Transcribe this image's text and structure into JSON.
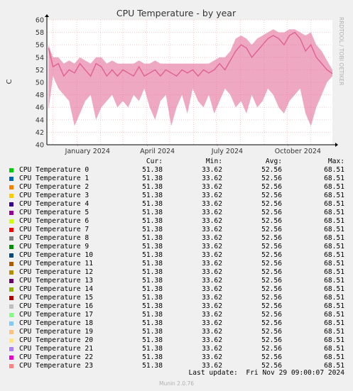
{
  "chart_data": {
    "type": "line",
    "title": "CPU Temperature - by year",
    "ylabel": "C",
    "ylim": [
      40,
      60
    ],
    "yticks": [
      "40",
      "42",
      "44",
      "46",
      "48",
      "50",
      "52",
      "54",
      "56",
      "58",
      "60"
    ],
    "xticks": [
      "January 2024",
      "April 2024",
      "July 2024",
      "October 2024"
    ],
    "xlim": [
      "2023-11-23",
      "2024-11-29"
    ],
    "grid": true,
    "series_color": "#e06090",
    "series": [
      {
        "name": "CPU Temperature 0",
        "x": [
          "2023-11-25",
          "2023-12-01",
          "2023-12-08",
          "2023-12-15",
          "2023-12-22",
          "2023-12-29",
          "2024-01-05",
          "2024-01-12",
          "2024-01-19",
          "2024-01-26",
          "2024-02-02",
          "2024-02-09",
          "2024-02-16",
          "2024-02-23",
          "2024-03-01",
          "2024-03-08",
          "2024-03-15",
          "2024-03-22",
          "2024-03-29",
          "2024-04-05",
          "2024-04-12",
          "2024-04-19",
          "2024-04-26",
          "2024-05-03",
          "2024-05-10",
          "2024-05-17",
          "2024-05-24",
          "2024-05-31",
          "2024-06-07",
          "2024-06-14",
          "2024-06-21",
          "2024-06-28",
          "2024-07-05",
          "2024-07-12",
          "2024-07-19",
          "2024-07-26",
          "2024-08-02",
          "2024-08-09",
          "2024-08-16",
          "2024-08-23",
          "2024-08-30",
          "2024-09-06",
          "2024-09-13",
          "2024-09-20",
          "2024-09-27",
          "2024-10-04",
          "2024-10-11",
          "2024-10-18",
          "2024-10-25",
          "2024-11-01",
          "2024-11-08",
          "2024-11-15",
          "2024-11-22",
          "2024-11-29"
        ],
        "y": [
          55.5,
          52.5,
          53,
          51,
          52,
          51.5,
          53,
          52,
          51,
          53,
          52.5,
          51,
          52,
          51,
          52,
          51.5,
          51,
          52.5,
          51,
          51.5,
          52,
          51,
          52,
          51.5,
          51,
          52,
          51.5,
          52,
          51,
          52,
          51.5,
          52,
          53,
          52,
          53.5,
          55,
          56,
          55.5,
          54,
          55,
          56,
          57,
          57.5,
          57,
          56,
          57.5,
          58,
          57,
          55,
          56,
          54,
          53,
          52,
          51.4
        ],
        "ymin": [
          45.5,
          51,
          49,
          48,
          47,
          43,
          45,
          47,
          48,
          44,
          46,
          47,
          48,
          46,
          47,
          46,
          48,
          47,
          49,
          46,
          44,
          47,
          48,
          43,
          46,
          48,
          45,
          49,
          47,
          46,
          48,
          45,
          47,
          49,
          48,
          46,
          47,
          45,
          48,
          46,
          47,
          49,
          48,
          46,
          45,
          47,
          48,
          49,
          45,
          43,
          46,
          48,
          50,
          51
        ],
        "ymax": [
          56,
          54,
          54,
          53,
          53.5,
          53,
          54,
          53.5,
          53,
          54,
          54,
          53,
          53.5,
          53,
          53,
          53,
          53,
          53.5,
          53,
          53,
          53.5,
          53,
          53,
          53,
          53,
          53,
          53,
          53,
          53,
          53,
          53,
          53.5,
          54,
          54,
          55,
          57,
          57.5,
          57,
          56,
          57,
          57.5,
          58,
          58.5,
          58,
          58,
          58.5,
          58.5,
          58,
          57.5,
          58,
          56,
          55,
          53.5,
          52
        ]
      }
    ]
  },
  "legend": {
    "headers": [
      "Cur:",
      "Min:",
      "Avg:",
      "Max:"
    ],
    "rows": [
      {
        "name": "CPU Temperature 0",
        "color": "#00cc00",
        "cur": "51.38",
        "min": "33.62",
        "avg": "52.56",
        "max": "68.51"
      },
      {
        "name": "CPU Temperature 1",
        "color": "#0066b3",
        "cur": "51.38",
        "min": "33.62",
        "avg": "52.56",
        "max": "68.51"
      },
      {
        "name": "CPU Temperature 2",
        "color": "#ff8000",
        "cur": "51.38",
        "min": "33.62",
        "avg": "52.56",
        "max": "68.51"
      },
      {
        "name": "CPU Temperature 3",
        "color": "#ffcc00",
        "cur": "51.38",
        "min": "33.62",
        "avg": "52.56",
        "max": "68.51"
      },
      {
        "name": "CPU Temperature 4",
        "color": "#330099",
        "cur": "51.38",
        "min": "33.62",
        "avg": "52.56",
        "max": "68.51"
      },
      {
        "name": "CPU Temperature 5",
        "color": "#990099",
        "cur": "51.38",
        "min": "33.62",
        "avg": "52.56",
        "max": "68.51"
      },
      {
        "name": "CPU Temperature 6",
        "color": "#ccff00",
        "cur": "51.38",
        "min": "33.62",
        "avg": "52.56",
        "max": "68.51"
      },
      {
        "name": "CPU Temperature 7",
        "color": "#ff0000",
        "cur": "51.38",
        "min": "33.62",
        "avg": "52.56",
        "max": "68.51"
      },
      {
        "name": "CPU Temperature 8",
        "color": "#808080",
        "cur": "51.38",
        "min": "33.62",
        "avg": "52.56",
        "max": "68.51"
      },
      {
        "name": "CPU Temperature 9",
        "color": "#008f00",
        "cur": "51.38",
        "min": "33.62",
        "avg": "52.56",
        "max": "68.51"
      },
      {
        "name": "CPU Temperature 10",
        "color": "#00487d",
        "cur": "51.38",
        "min": "33.62",
        "avg": "52.56",
        "max": "68.51"
      },
      {
        "name": "CPU Temperature 11",
        "color": "#b35a00",
        "cur": "51.38",
        "min": "33.62",
        "avg": "52.56",
        "max": "68.51"
      },
      {
        "name": "CPU Temperature 12",
        "color": "#b38f00",
        "cur": "51.38",
        "min": "33.62",
        "avg": "52.56",
        "max": "68.51"
      },
      {
        "name": "CPU Temperature 13",
        "color": "#6b006b",
        "cur": "51.38",
        "min": "33.62",
        "avg": "52.56",
        "max": "68.51"
      },
      {
        "name": "CPU Temperature 14",
        "color": "#8fb300",
        "cur": "51.38",
        "min": "33.62",
        "avg": "52.56",
        "max": "68.51"
      },
      {
        "name": "CPU Temperature 15",
        "color": "#b30000",
        "cur": "51.38",
        "min": "33.62",
        "avg": "52.56",
        "max": "68.51"
      },
      {
        "name": "CPU Temperature 16",
        "color": "#bebebe",
        "cur": "51.38",
        "min": "33.62",
        "avg": "52.56",
        "max": "68.51"
      },
      {
        "name": "CPU Temperature 17",
        "color": "#80ff80",
        "cur": "51.38",
        "min": "33.62",
        "avg": "52.56",
        "max": "68.51"
      },
      {
        "name": "CPU Temperature 18",
        "color": "#80c9ff",
        "cur": "51.38",
        "min": "33.62",
        "avg": "52.56",
        "max": "68.51"
      },
      {
        "name": "CPU Temperature 19",
        "color": "#ffc080",
        "cur": "51.38",
        "min": "33.62",
        "avg": "52.56",
        "max": "68.51"
      },
      {
        "name": "CPU Temperature 20",
        "color": "#ffe680",
        "cur": "51.38",
        "min": "33.62",
        "avg": "52.56",
        "max": "68.51"
      },
      {
        "name": "CPU Temperature 21",
        "color": "#aa80ff",
        "cur": "51.38",
        "min": "33.62",
        "avg": "52.56",
        "max": "68.51"
      },
      {
        "name": "CPU Temperature 22",
        "color": "#ee00cc",
        "cur": "51.38",
        "min": "33.62",
        "avg": "52.56",
        "max": "68.51"
      },
      {
        "name": "CPU Temperature 23",
        "color": "#ff8080",
        "cur": "51.38",
        "min": "33.62",
        "avg": "52.56",
        "max": "68.51"
      }
    ]
  },
  "footer": {
    "last_update": "Last update:  Fri Nov 29 09:00:07 2024",
    "version": "Munin 2.0.76"
  },
  "side_label": "RRDTOOL / TOBI OETIKER"
}
